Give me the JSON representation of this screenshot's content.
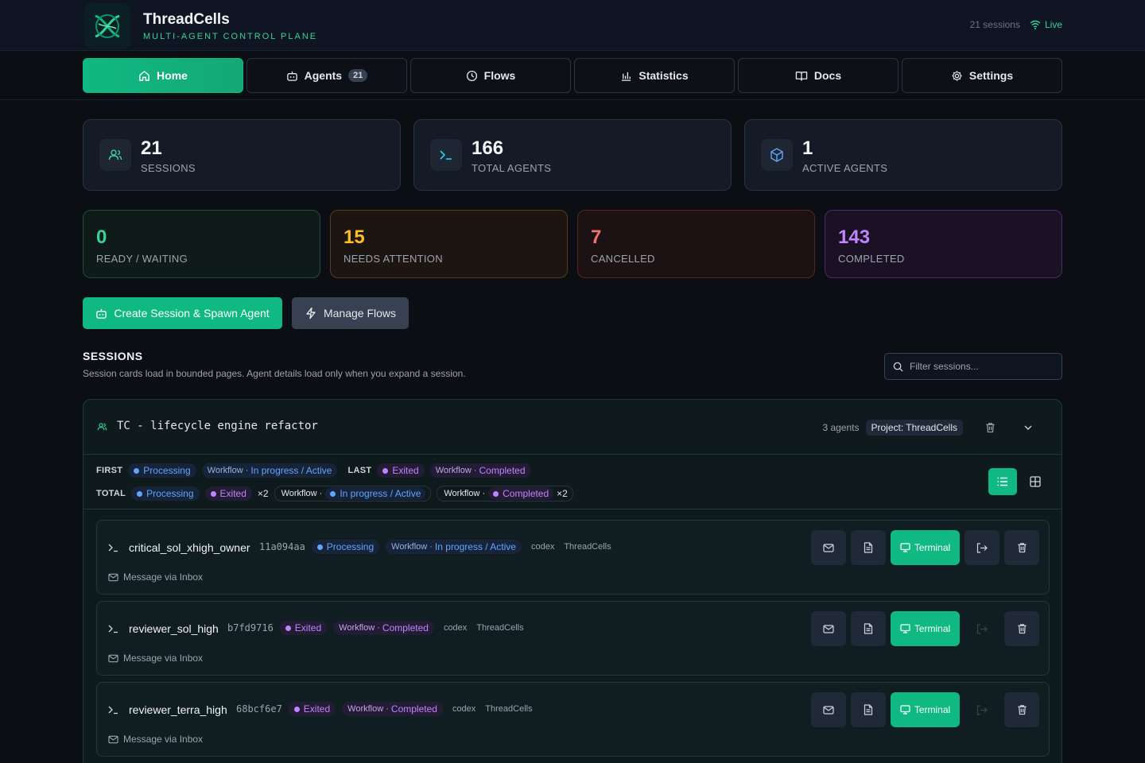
{
  "header": {
    "title": "ThreadCells",
    "subtitle": "MULTI-AGENT CONTROL PLANE",
    "sessions_count": "21 sessions",
    "live_label": "Live"
  },
  "nav": {
    "tabs": [
      {
        "label": "Home",
        "icon": "home-icon",
        "active": true
      },
      {
        "label": "Agents",
        "icon": "robot-icon",
        "badge": "21"
      },
      {
        "label": "Flows",
        "icon": "clock-icon"
      },
      {
        "label": "Statistics",
        "icon": "bar-chart-icon"
      },
      {
        "label": "Docs",
        "icon": "book-icon"
      },
      {
        "label": "Settings",
        "icon": "gear-icon"
      }
    ]
  },
  "stats": [
    {
      "value": "21",
      "label": "SESSIONS",
      "icon": "users-icon"
    },
    {
      "value": "166",
      "label": "TOTAL AGENTS",
      "icon": "terminal-icon"
    },
    {
      "value": "1",
      "label": "ACTIVE AGENTS",
      "icon": "cube-icon"
    }
  ],
  "statuses": [
    {
      "value": "0",
      "label": "READY / WAITING",
      "color": "#34d399",
      "border": "#1f4a3a",
      "bg": "#0f1b18"
    },
    {
      "value": "15",
      "label": "NEEDS ATTENTION",
      "color": "#fbbf24",
      "border": "#5a3a1a",
      "bg": "#1c1512"
    },
    {
      "value": "7",
      "label": "CANCELLED",
      "color": "#f87171",
      "border": "#5a2424",
      "bg": "#1c1213"
    },
    {
      "value": "143",
      "label": "COMPLETED",
      "color": "#c084fc",
      "border": "#4a2a6a",
      "bg": "#1a1224"
    }
  ],
  "actions": {
    "create": "Create Session & Spawn Agent",
    "manage": "Manage Flows"
  },
  "sessions_section": {
    "title": "SESSIONS",
    "description": "Session cards load in bounded pages. Agent details load only when you expand a session.",
    "filter_placeholder": "Filter sessions..."
  },
  "session": {
    "name": "TC - lifecycle engine refactor",
    "agents_count": "3 agents",
    "project": "Project: ThreadCells",
    "summary": {
      "first_label": "FIRST",
      "first_status": "Processing",
      "first_wf_key": "Workflow ·",
      "first_wf_value": "In progress / Active",
      "last_label": "LAST",
      "last_status": "Exited",
      "last_wf_key": "Workflow ·",
      "last_wf_value": "Completed",
      "total_label": "TOTAL",
      "total_processing": "Processing",
      "total_exited": "Exited",
      "total_exited_mult": "×2",
      "wf1_key": "Workflow ·",
      "wf1_value": "In progress / Active",
      "wf2_key": "Workflow ·",
      "wf2_value": "Completed",
      "wf2_mult": "×2"
    },
    "agents": [
      {
        "name": "critical_sol_xhigh_owner",
        "hash": "11a094aa",
        "status": "Processing",
        "status_color": "blue",
        "wf_key": "Workflow ·",
        "wf_value": "In progress / Active",
        "tool": "codex",
        "project": "ThreadCells",
        "message": "Message via Inbox",
        "terminal": "Terminal",
        "exit_enabled": true
      },
      {
        "name": "reviewer_sol_high",
        "hash": "b7fd9716",
        "status": "Exited",
        "status_color": "purple",
        "wf_key": "Workflow ·",
        "wf_value": "Completed",
        "tool": "codex",
        "project": "ThreadCells",
        "message": "Message via Inbox",
        "terminal": "Terminal",
        "exit_enabled": false
      },
      {
        "name": "reviewer_terra_high",
        "hash": "68bcf6e7",
        "status": "Exited",
        "status_color": "purple",
        "wf_key": "Workflow ·",
        "wf_value": "Completed",
        "tool": "codex",
        "project": "ThreadCells",
        "message": "Message via Inbox",
        "terminal": "Terminal",
        "exit_enabled": false
      }
    ]
  }
}
